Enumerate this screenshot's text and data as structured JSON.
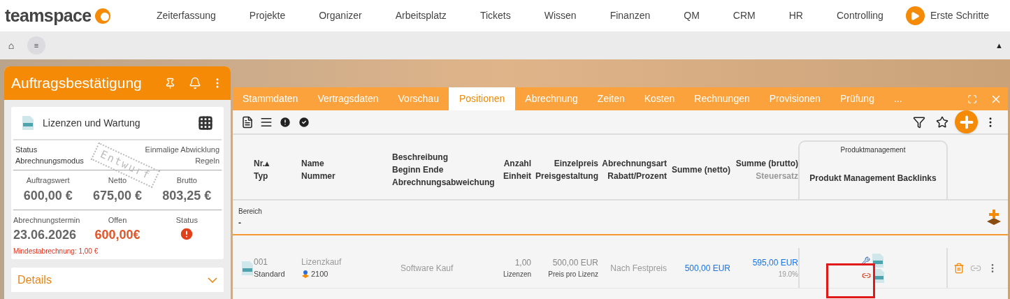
{
  "brand": "teamspace",
  "nav": [
    {
      "label": "Zeiterfassung"
    },
    {
      "label": "Projekte"
    },
    {
      "label": "Organizer"
    },
    {
      "label": "Arbeitsplatz"
    },
    {
      "label": "Tickets"
    },
    {
      "label": "Wissen"
    },
    {
      "label": "Finanzen"
    },
    {
      "label": "QM"
    },
    {
      "label": "CRM"
    },
    {
      "label": "HR"
    },
    {
      "label": "Controlling"
    }
  ],
  "first_steps": "Erste Schritte",
  "toolbar": {
    "home": "⌂",
    "menu": "≡",
    "collapse": "▲"
  },
  "side_panel": {
    "title": "Auftragsbestätigung",
    "card_title": "Lizenzen und Wartung",
    "stamp": "Entwurf",
    "info": [
      {
        "label": "Status",
        "value": "Einmalige Abwicklung"
      },
      {
        "label": "Abrechnungsmodus",
        "value": "Regeln"
      }
    ],
    "amounts": [
      {
        "label": "Auftragswert",
        "value": "600,00 €"
      },
      {
        "label": "Netto",
        "value": "675,00 €"
      },
      {
        "label": "Brutto",
        "value": "803,25 €"
      }
    ],
    "billing": {
      "date_label": "Abrechnungstermin",
      "date": "23.06.2026",
      "open_label": "Offen",
      "open": "600,00€",
      "status_label": "Status",
      "status_alert": true
    },
    "minimum": "Mindestabrechnung: 1,00 €",
    "details": {
      "label": "Details",
      "expanded": false
    }
  },
  "tabs": [
    {
      "label": "Stammdaten",
      "selected": false
    },
    {
      "label": "Vertragsdaten",
      "selected": false
    },
    {
      "label": "Vorschau",
      "selected": false
    },
    {
      "label": "Positionen",
      "selected": true
    },
    {
      "label": "Abrechnung",
      "selected": false
    },
    {
      "label": "Zeiten",
      "selected": false
    },
    {
      "label": "Kosten",
      "selected": false
    },
    {
      "label": "Rechnungen",
      "selected": false
    },
    {
      "label": "Provisionen",
      "selected": false
    },
    {
      "label": "Prüfung",
      "selected": false
    },
    {
      "label": "...",
      "selected": false
    }
  ],
  "table": {
    "group_header": "Produktmanagement",
    "columns": [
      [
        "Nr.▴",
        "Typ"
      ],
      [
        "Name",
        "Nummer"
      ],
      [
        "Beschreibung",
        "Beginn Ende",
        "Abrechnungsabweichung"
      ],
      [
        "Anzahl",
        "Einheit"
      ],
      [
        "Einzelpreis",
        "Preisgestaltung"
      ],
      [
        "Abrechnungsart",
        "Rabatt/Prozent"
      ],
      [
        "Summe (netto)"
      ],
      [
        "Summe (brutto)",
        "Steuersatz"
      ],
      [
        "Produkt Management Backlinks"
      ]
    ],
    "section": {
      "label": "Bereich",
      "value": "-"
    },
    "rows": [
      {
        "nr": "001",
        "typ": "Standard",
        "name": "Lizenzkauf",
        "nummer": "2100",
        "beschreibung": "Software Kauf",
        "anzahl": "1,00",
        "einheit": "Lizenzen",
        "einzelpreis": "500,00 EUR",
        "preisgestaltung": "Preis pro Lizenz",
        "abrechnungsart": "Nach Festpreis",
        "netto": "500,00 EUR",
        "brutto": "595,00 EUR",
        "steuersatz": "19.0%",
        "highlighted": true
      }
    ]
  }
}
